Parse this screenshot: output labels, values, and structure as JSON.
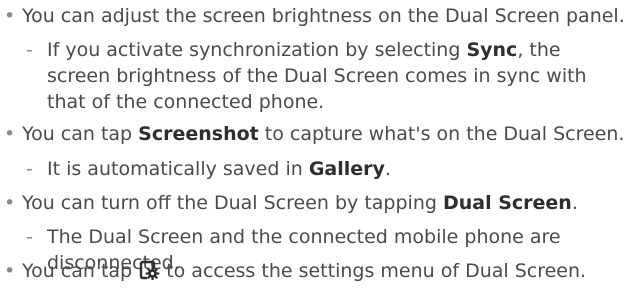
{
  "bullets": [
    {
      "intro": "You can adjust the screen brightness on the Dual Screen panel.",
      "subs": [
        {
          "pre": "If you activate synchronization by selecting ",
          "bold": "Sync",
          "post": ", the screen brightness of the Dual Screen comes in sync with that of the connected phone."
        }
      ]
    },
    {
      "pre": "You can tap ",
      "bold": "Screenshot",
      "post": " to capture what's on the Dual Screen.",
      "subs": [
        {
          "pre": "It is automatically saved in ",
          "bold": "Gallery",
          "post": "."
        }
      ]
    },
    {
      "pre": "You can turn off the Dual Screen by tapping ",
      "bold": "Dual Screen",
      "post": ".",
      "subs": [
        {
          "text": "The Dual Screen and the connected mobile phone are disconnected."
        }
      ]
    },
    {
      "pre": "You can tap ",
      "icon": "dual-screen-settings-icon",
      "post": " to access the settings menu of Dual Screen."
    }
  ],
  "bullet_glyph": "•",
  "dash_glyph": "-"
}
